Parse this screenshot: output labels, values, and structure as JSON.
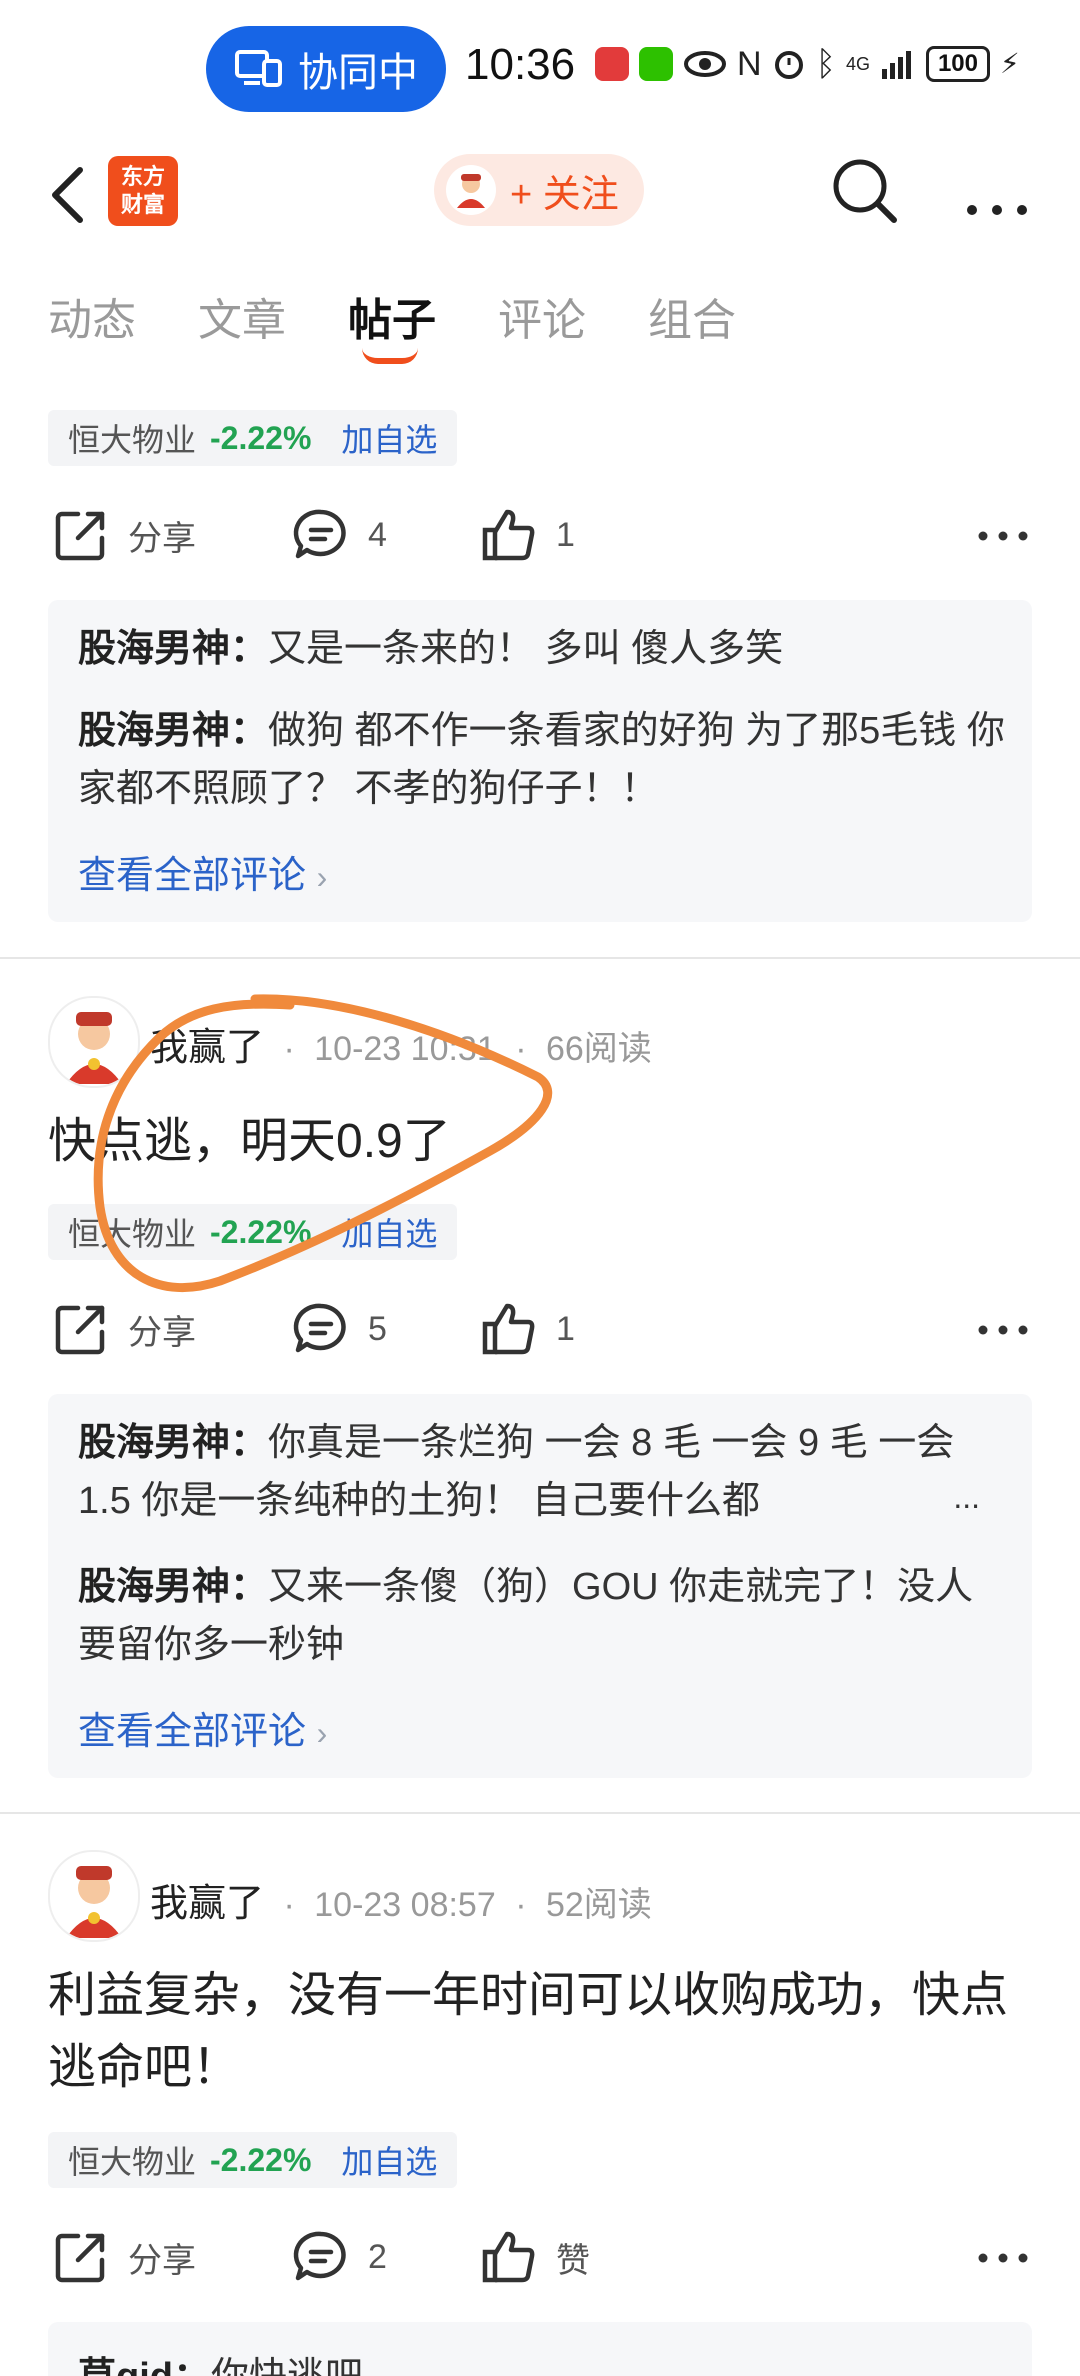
{
  "status_bar": {
    "collab_label": "协同中",
    "time": "10:36",
    "network_label": "4G",
    "battery": "100"
  },
  "nav": {
    "logo_line1": "东方",
    "logo_line2": "财富",
    "follow_label": "+ 关注"
  },
  "tabs": [
    {
      "label": "动态"
    },
    {
      "label": "文章"
    },
    {
      "label": "帖子"
    },
    {
      "label": "评论"
    },
    {
      "label": "组合"
    }
  ],
  "active_tab": "帖子",
  "posts": [
    {
      "stock": {
        "name": "恒大物业",
        "change": "-2.22%",
        "add_label": "加自选"
      },
      "actions": {
        "share_label": "分享",
        "comments": "4",
        "likes": "1"
      },
      "comments": [
        {
          "author": "股海男神：",
          "text": "又是一条来的！ 多叫 傻人多笑"
        },
        {
          "author": "股海男神：",
          "text": "做狗 都不作一条看家的好狗 为了那5毛钱 你家都不照顾了？ 不孝的狗仔子！！"
        }
      ],
      "view_all_label": "查看全部评论"
    },
    {
      "username": "我赢了",
      "time": "10-23 10:31",
      "reads": "66阅读",
      "text": "快点逃，明天0.9了",
      "stock": {
        "name": "恒大物业",
        "change": "-2.22%",
        "add_label": "加自选"
      },
      "actions": {
        "share_label": "分享",
        "comments": "5",
        "likes": "1"
      },
      "comments": [
        {
          "author": "股海男神：",
          "text": "你真是一条烂狗 一会 8 毛 一会 9 毛 一会 1.5 你是一条纯种的土狗！ 自己要什么都"
        },
        {
          "author": "股海男神：",
          "text": "又来一条傻（狗）GOU 你走就完了！没人要留你多一秒钟"
        }
      ],
      "ellipsis": "...",
      "view_all_label": "查看全部评论"
    },
    {
      "username": "我赢了",
      "time": "10-23 08:57",
      "reads": "52阅读",
      "text": "利益复杂，没有一年时间可以收购成功，快点逃命吧！",
      "stock": {
        "name": "恒大物业",
        "change": "-2.22%",
        "add_label": "加自选"
      },
      "actions": {
        "share_label": "分享",
        "comments": "2",
        "likes": "赞"
      },
      "comments": [
        {
          "author": "草gid：",
          "text": "你快逃吧"
        }
      ]
    }
  ],
  "meta_separator": "·",
  "colors": {
    "brand": "#f04e1c",
    "collab_blue": "#1765e6",
    "stock_down": "#22a352",
    "link": "#2b63c9",
    "annotation": "#f08a3c"
  }
}
